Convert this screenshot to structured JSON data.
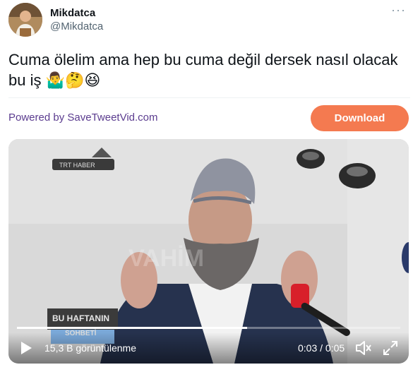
{
  "tweet": {
    "author_name": "Mikdatca",
    "author_handle": "@Mikdatca",
    "text": "Cuma ölelim ama hep bu cuma değil dersek nasıl olacak bu iş 🤷‍♂️🤔😆",
    "more_icon": "more-dots-icon"
  },
  "promo": {
    "powered_by": "Powered by SaveTweetVid.com",
    "download_label": "Download"
  },
  "video": {
    "overlay_text": {
      "logo": "TRT HABER",
      "watermark": "VAHİM",
      "banner_line1": "BU HAFTANIN",
      "banner_line2": "SOHBETİ"
    },
    "views": "15,3 B görüntülenme",
    "time": "0:03 / 0:05",
    "progress": 0.6,
    "icons": {
      "play": "play-icon",
      "mute": "mute-icon",
      "fullscreen": "fullscreen-icon"
    }
  },
  "colors": {
    "download": "#f47a50",
    "powered_by": "#5b3c8f",
    "handle": "#536471"
  }
}
